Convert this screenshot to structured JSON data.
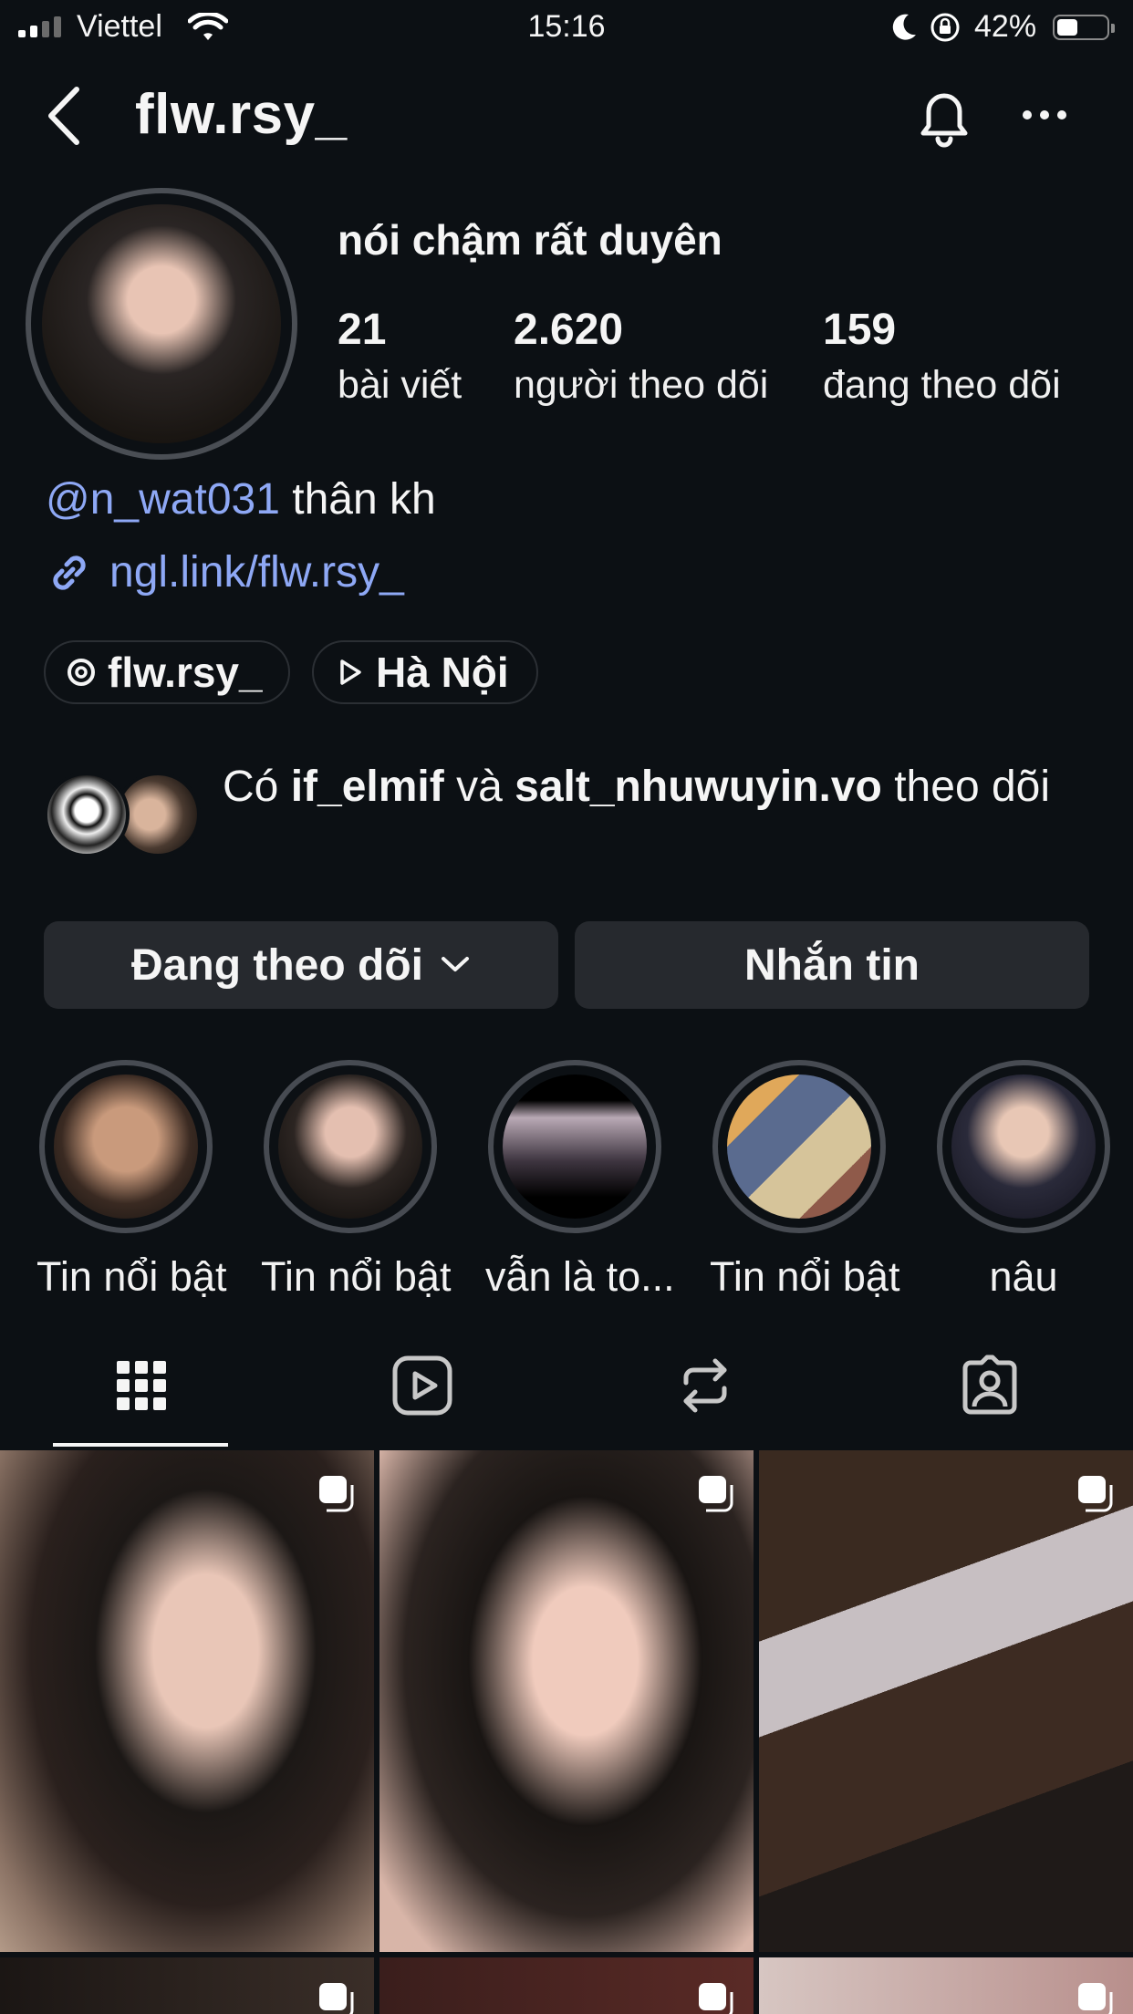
{
  "status_bar": {
    "carrier": "Viettel",
    "time": "15:16",
    "battery_percent": "42%"
  },
  "header": {
    "username": "flw.rsy_"
  },
  "profile": {
    "full_name": "nói chậm rất duyên",
    "stats": [
      {
        "value": "21",
        "label": "bài viết"
      },
      {
        "value": "2.620",
        "label": "người theo dõi"
      },
      {
        "value": "159",
        "label": "đang theo dõi"
      }
    ],
    "bio_mention": "@n_wat031",
    "bio_text": "thân kh",
    "link": "ngl.link/flw.rsy_",
    "threads_chip": "flw.rsy_",
    "location_chip": "Hà Nội"
  },
  "mutuals": {
    "prefix": "Có",
    "user1": "if_elmif",
    "and": "và",
    "user2": "salt_nhuwuyin.vo",
    "suffix": "theo dõi"
  },
  "actions": {
    "following_label": "Đang theo dõi",
    "message_label": "Nhắn tin"
  },
  "highlights": [
    {
      "label": "Tin nổi bật"
    },
    {
      "label": "Tin nổi bật"
    },
    {
      "label": "vẫn là to..."
    },
    {
      "label": "Tin nổi bật"
    },
    {
      "label": "nâu"
    }
  ],
  "tabs": [
    "grid-icon",
    "reels-icon",
    "reposts-icon",
    "tagged-icon"
  ],
  "colors": {
    "background": "#0c1014",
    "link": "#8ea8f5",
    "button": "#26292e"
  }
}
